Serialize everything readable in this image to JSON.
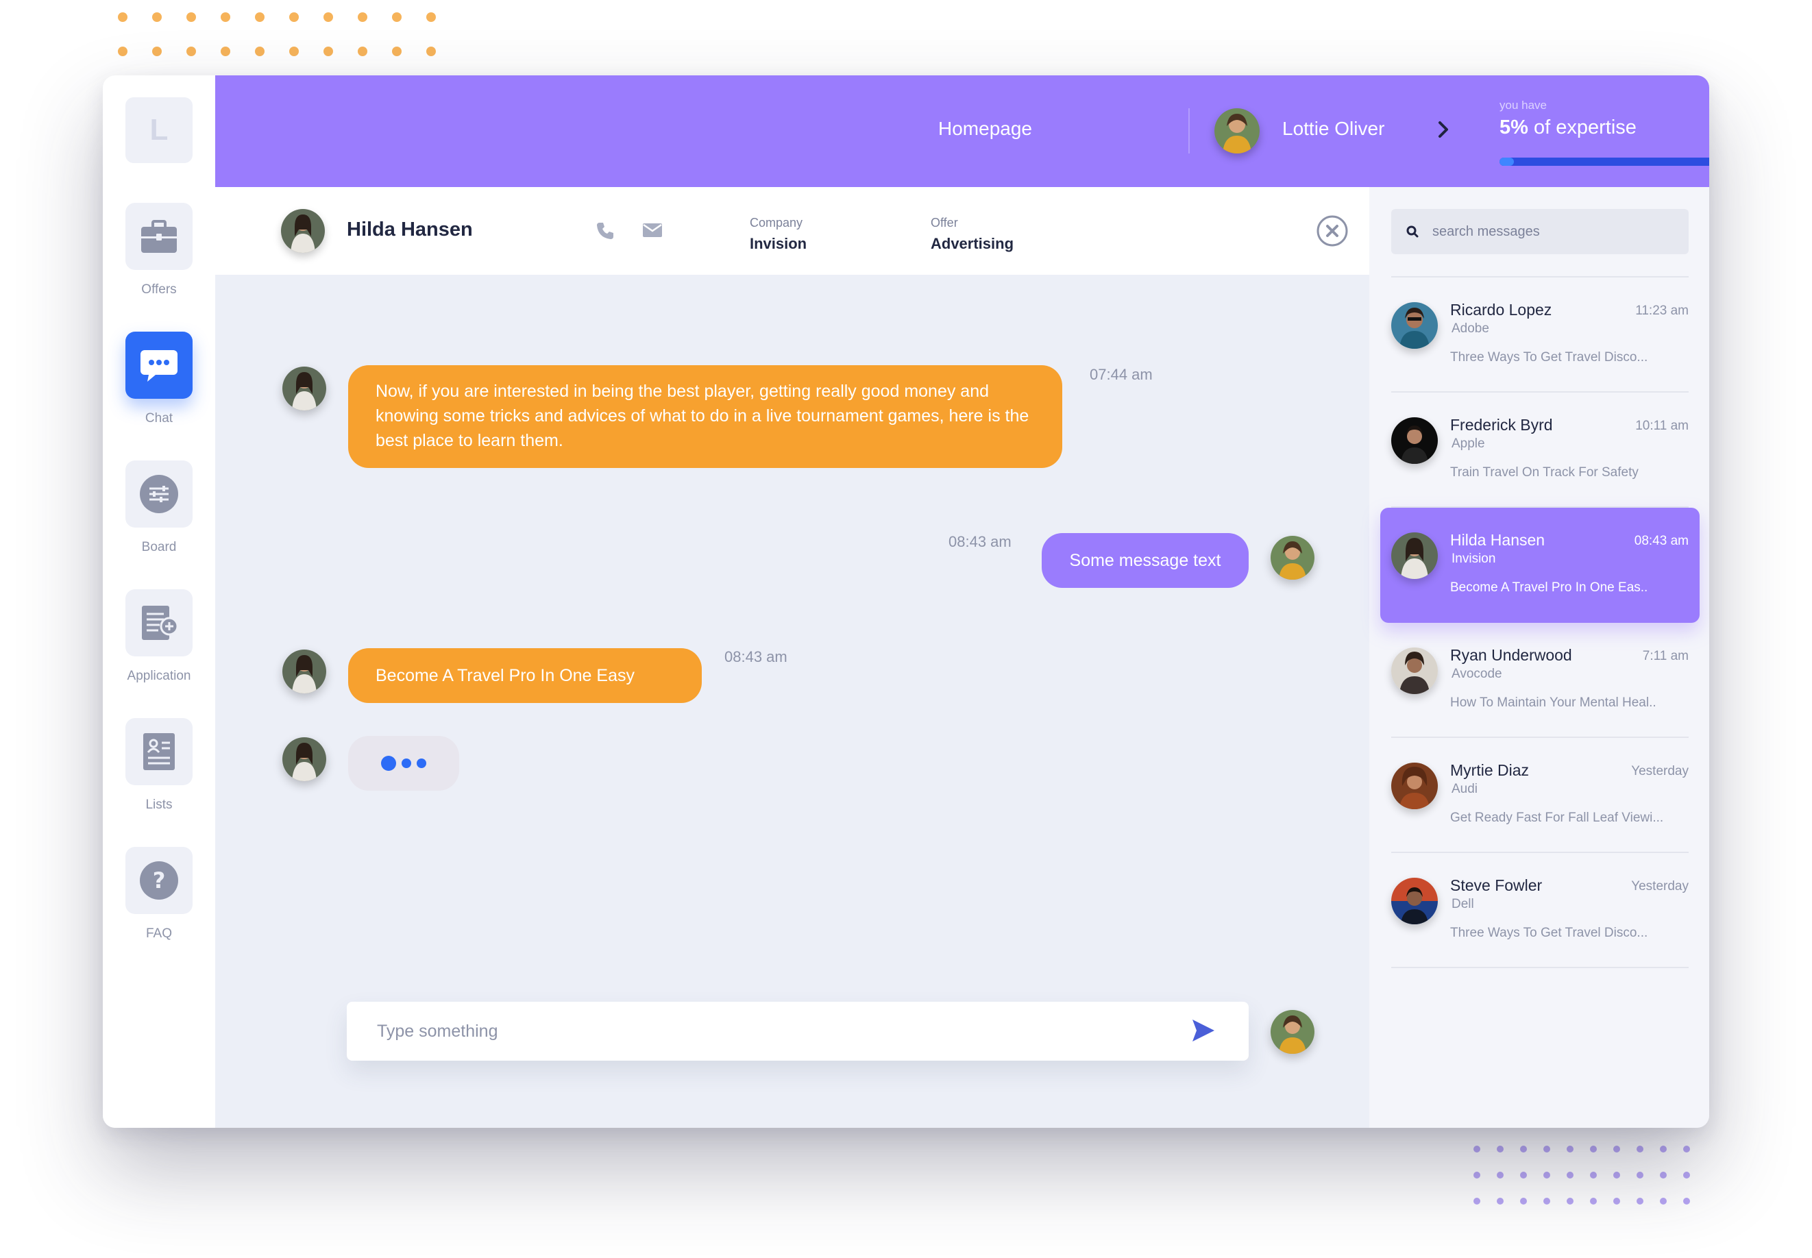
{
  "sidebar": {
    "logo_letter": "L",
    "items": [
      {
        "label": "Offers",
        "icon": "briefcase-icon",
        "active": false
      },
      {
        "label": "Chat",
        "icon": "chat-bubble-icon",
        "active": true
      },
      {
        "label": "Board",
        "icon": "sliders-icon",
        "active": false
      },
      {
        "label": "Application",
        "icon": "document-add-icon",
        "active": false
      },
      {
        "label": "Lists",
        "icon": "id-card-icon",
        "active": false
      },
      {
        "label": "FAQ",
        "icon": "help-icon",
        "active": false
      }
    ]
  },
  "header": {
    "homepage": "Homepage",
    "user_name": "Lottie Oliver",
    "expertise_label": "you have",
    "expertise_percent": "5%",
    "expertise_suffix": " of expertise",
    "expertise_fraction": 0.05
  },
  "contact": {
    "name": "Hilda Hansen",
    "company_label": "Company",
    "company_value": "Invision",
    "offer_label": "Offer",
    "offer_value": "Advertising"
  },
  "messages": [
    {
      "direction": "in",
      "text": "Now, if you are interested in being the best player, getting really good money and knowing some tricks and advices of what to do in a live tournament games, here is the best place to learn them.",
      "time": "07:44 am"
    },
    {
      "direction": "out",
      "text": "Some message text",
      "time": "08:43 am"
    },
    {
      "direction": "in",
      "text": "Become A Travel Pro In One Easy",
      "time": "08:43 am"
    }
  ],
  "composer": {
    "placeholder": "Type something"
  },
  "search": {
    "placeholder": "search messages"
  },
  "conversations": [
    {
      "name": "Ricardo Lopez",
      "company": "Adobe",
      "time": "11:23 am",
      "preview": "Three Ways To Get Travel Disco...",
      "active": false
    },
    {
      "name": "Frederick Byrd",
      "company": "Apple",
      "time": "10:11 am",
      "preview": "Train Travel On Track For Safety",
      "active": false
    },
    {
      "name": "Hilda Hansen",
      "company": "Invision",
      "time": "08:43 am",
      "preview": "Become A Travel Pro In One Eas..",
      "active": true
    },
    {
      "name": "Ryan Underwood",
      "company": "Avocode",
      "time": "7:11 am",
      "preview": "How To Maintain Your Mental Heal..",
      "active": false
    },
    {
      "name": "Myrtie Diaz",
      "company": "Audi",
      "time": "Yesterday",
      "preview": "Get Ready Fast For Fall Leaf Viewi...",
      "active": false
    },
    {
      "name": "Steve Fowler",
      "company": "Dell",
      "time": "Yesterday",
      "preview": "Three Ways To Get Travel Disco...",
      "active": false
    }
  ],
  "colors": {
    "accent_purple": "#9a7cfd",
    "accent_blue": "#2d6cf6",
    "incoming_orange": "#f7a12f",
    "background": "#eceff7"
  }
}
